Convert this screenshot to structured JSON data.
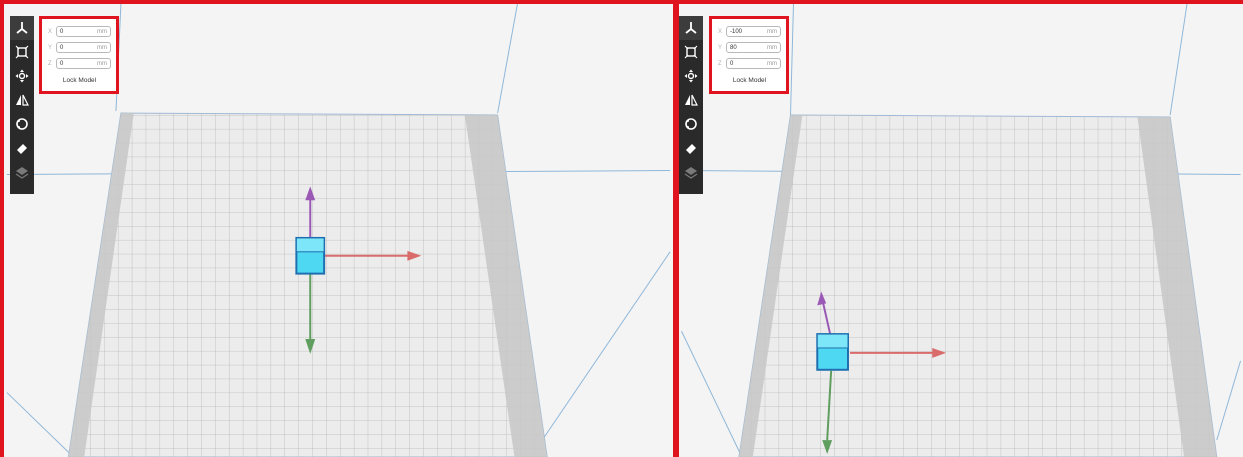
{
  "toolbar_items": [
    {
      "name": "move-tool",
      "icon": "move-axes-icon",
      "state": "active"
    },
    {
      "name": "scale-tool",
      "icon": "scale-icon",
      "state": "normal"
    },
    {
      "name": "rotate-tool",
      "icon": "rotate-icon",
      "state": "normal"
    },
    {
      "name": "mirror-tool",
      "icon": "mirror-icon",
      "state": "normal"
    },
    {
      "name": "lay-flat-tool",
      "icon": "circle-icon",
      "state": "normal"
    },
    {
      "name": "support-tool",
      "icon": "eraser-icon",
      "state": "normal"
    },
    {
      "name": "layers-tool",
      "icon": "layers-icon",
      "state": "disabled"
    }
  ],
  "left": {
    "axis_labels": {
      "x": "X",
      "y": "Y",
      "z": "Z"
    },
    "x_value": "0",
    "y_value": "0",
    "z_value": "0",
    "unit": "mm",
    "lock_label": "Lock Model"
  },
  "right": {
    "axis_labels": {
      "x": "X",
      "y": "Y",
      "z": "Z"
    },
    "x_value": "-100",
    "y_value": "80",
    "z_value": "0",
    "unit": "mm",
    "lock_label": "Lock Model"
  },
  "colors": {
    "highlight_border": "#e0141e",
    "grid_line": "#b8b8b8",
    "bed": "#ececec",
    "model": "#4fd8f2",
    "axis_x": "#d96b6b",
    "axis_y": "#5f9e5f",
    "axis_z": "#9b59b6"
  }
}
